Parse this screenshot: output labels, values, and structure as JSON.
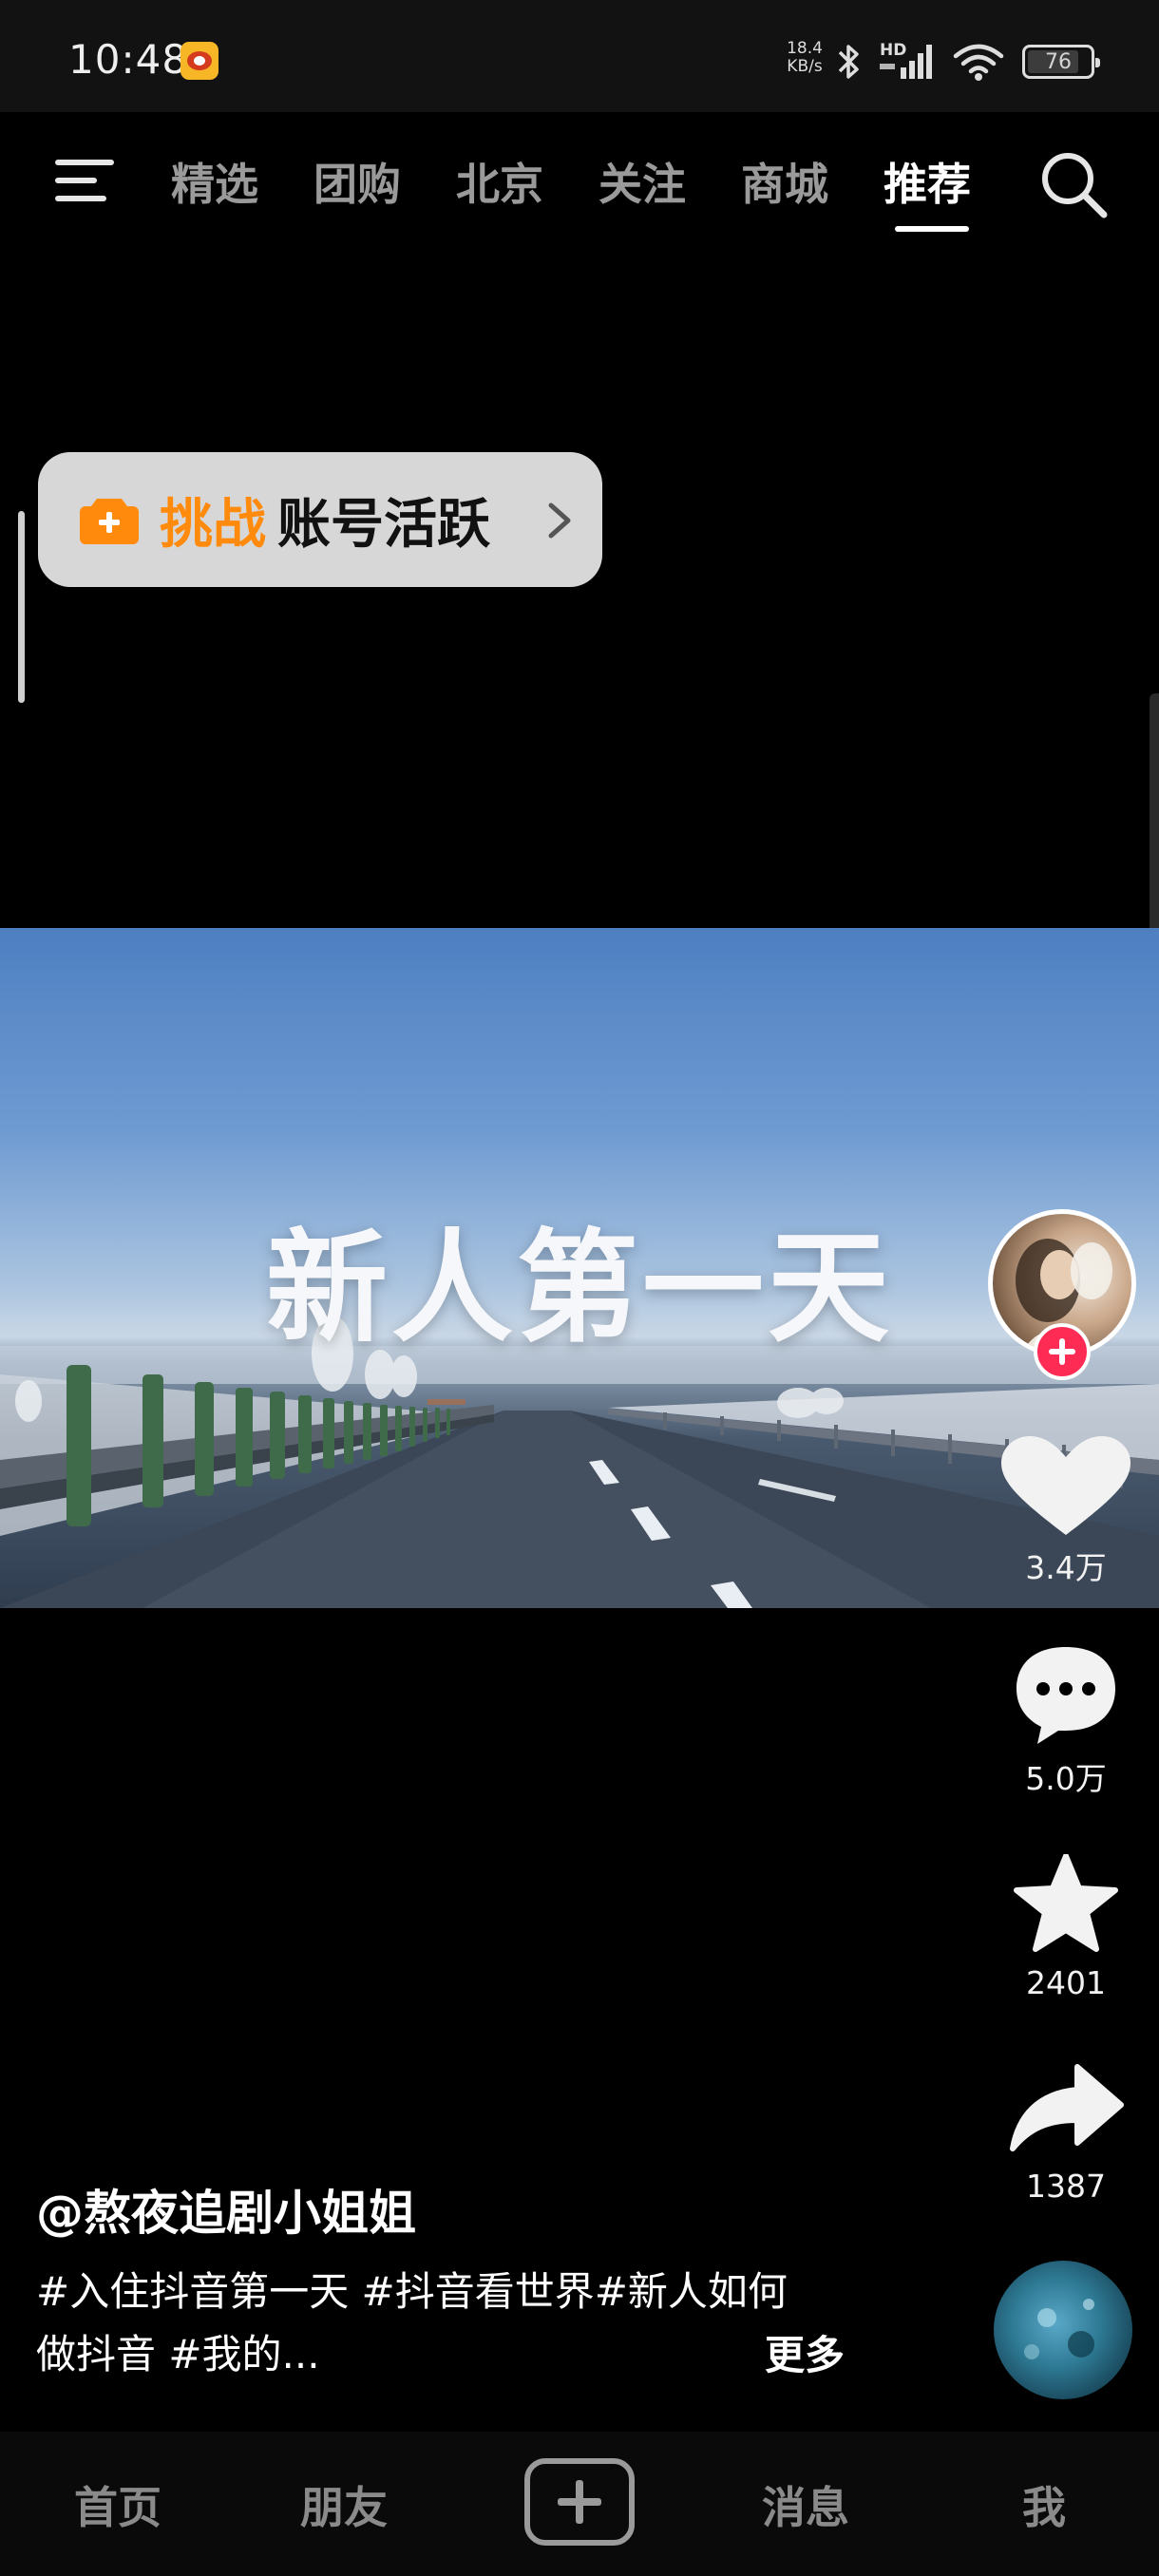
{
  "status_bar": {
    "time": "10:48",
    "net_speed_value": "18.4",
    "net_speed_unit": "KB/s",
    "hd_label": "HD",
    "battery": "76",
    "icons": [
      "app-notification-icon",
      "bluetooth-icon",
      "cellular-signal-icon",
      "wifi-icon",
      "battery-icon"
    ]
  },
  "top_nav": {
    "tabs": [
      "精选",
      "团购",
      "北京",
      "关注",
      "商城",
      "推荐"
    ],
    "active_tab": "推荐"
  },
  "challenge_chip": {
    "highlight": "挑战",
    "text": "账号活跃",
    "accent_color": "#ff8a0c"
  },
  "video": {
    "caption": "新人第一天"
  },
  "actions": {
    "likes": "3.4万",
    "comments": "5.0万",
    "favorites": "2401",
    "shares": "1387"
  },
  "post": {
    "author": "@熬夜追剧小姐姐",
    "description_line1": "#入住抖音第一天 #抖音看世界#新人如何",
    "description_line2": "做抖音 #我的...",
    "more": "更多"
  },
  "bottom_nav": {
    "home": "首页",
    "friends": "朋友",
    "messages": "消息",
    "me": "我"
  },
  "colors": {
    "follow_accent": "#fe2c55",
    "background": "#000000"
  }
}
